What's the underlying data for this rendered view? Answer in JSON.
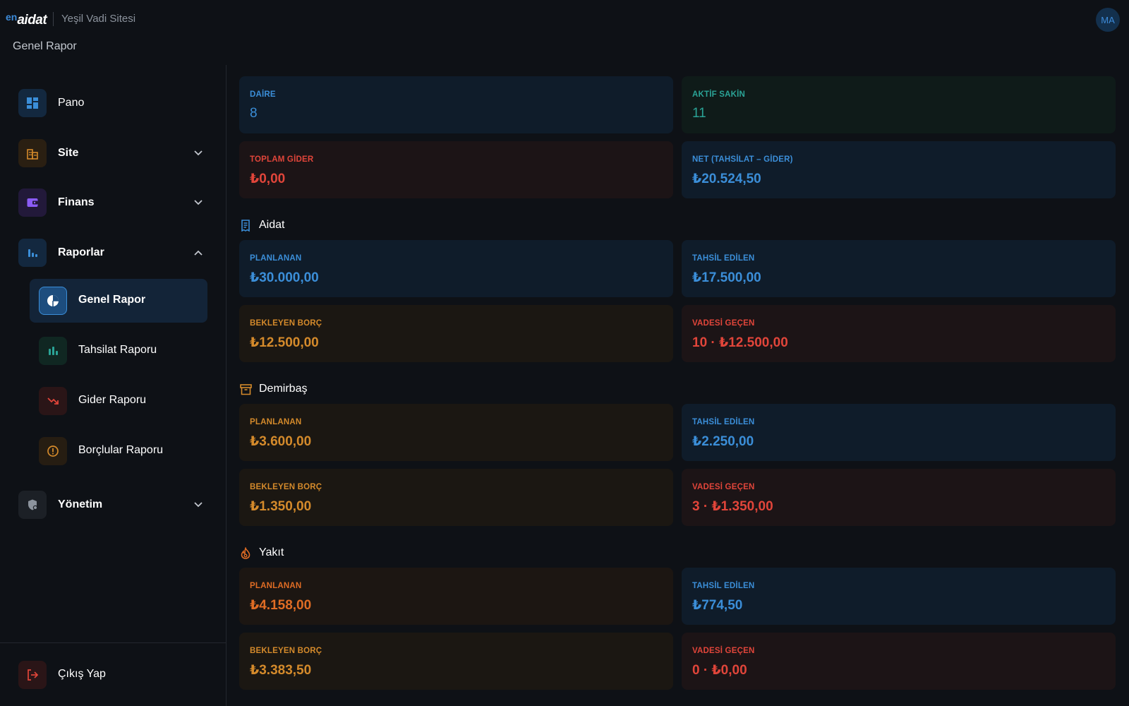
{
  "header": {
    "logo_prefix": "en",
    "logo_text": "aidat",
    "site_name": "Yeşil Vadi Sitesi",
    "avatar_initials": "MA",
    "page_title": "Genel Rapor"
  },
  "sidebar": {
    "items": [
      {
        "label": "Pano",
        "icon": "dashboard-icon"
      },
      {
        "label": "Site",
        "icon": "buildings-icon"
      },
      {
        "label": "Finans",
        "icon": "wallet-icon"
      },
      {
        "label": "Raporlar",
        "icon": "bar-chart-icon"
      },
      {
        "label": "Yönetim",
        "icon": "shield-gear-icon"
      }
    ],
    "report_items": [
      {
        "label": "Genel Rapor",
        "icon": "pie-chart-icon"
      },
      {
        "label": "Tahsilat Raporu",
        "icon": "bar-chart-icon"
      },
      {
        "label": "Gider Raporu",
        "icon": "trending-down-icon"
      },
      {
        "label": "Borçlular Raporu",
        "icon": "alert-circle-icon"
      }
    ],
    "logout_label": "Çıkış Yap"
  },
  "summary": {
    "daire": {
      "label": "DAİRE",
      "value": "8"
    },
    "aktif_sakin": {
      "label": "AKTİF SAKİN",
      "value": "11"
    },
    "toplam_gider": {
      "label": "TOPLAM GİDER",
      "value": "₺0,00"
    },
    "net": {
      "label": "NET (TAHSİLAT – GİDER)",
      "value": "₺20.524,50"
    }
  },
  "sections": [
    {
      "title": "Aidat",
      "icon": "receipt-icon",
      "planlanan": {
        "label": "PLANLANAN",
        "value": "₺30.000,00"
      },
      "tahsil": {
        "label": "TAHSİL EDİLEN",
        "value": "₺17.500,00"
      },
      "bekleyen": {
        "label": "BEKLEYEN BORÇ",
        "value": "₺12.500,00"
      },
      "vadesi": {
        "label": "VADESİ GEÇEN",
        "value": "10 · ₺12.500,00"
      }
    },
    {
      "title": "Demirbaş",
      "icon": "archive-box-icon",
      "planlanan": {
        "label": "PLANLANAN",
        "value": "₺3.600,00"
      },
      "tahsil": {
        "label": "TAHSİL EDİLEN",
        "value": "₺2.250,00"
      },
      "bekleyen": {
        "label": "BEKLEYEN BORÇ",
        "value": "₺1.350,00"
      },
      "vadesi": {
        "label": "VADESİ GEÇEN",
        "value": "3 · ₺1.350,00"
      }
    },
    {
      "title": "Yakıt",
      "icon": "flame-icon",
      "planlanan": {
        "label": "PLANLANAN",
        "value": "₺4.158,00"
      },
      "tahsil": {
        "label": "TAHSİL EDİLEN",
        "value": "₺774,50"
      },
      "bekleyen": {
        "label": "BEKLEYEN BORÇ",
        "value": "₺3.383,50"
      },
      "vadesi": {
        "label": "VADESİ GEÇEN",
        "value": "0 · ₺0,00"
      }
    }
  ],
  "colors": {
    "background": "#0e1116",
    "accent_blue": "#3b8ed8",
    "accent_green": "#2aa396",
    "accent_red": "#e1453a",
    "accent_orange": "#d48a2b",
    "accent_purple": "#8b5cf6"
  }
}
